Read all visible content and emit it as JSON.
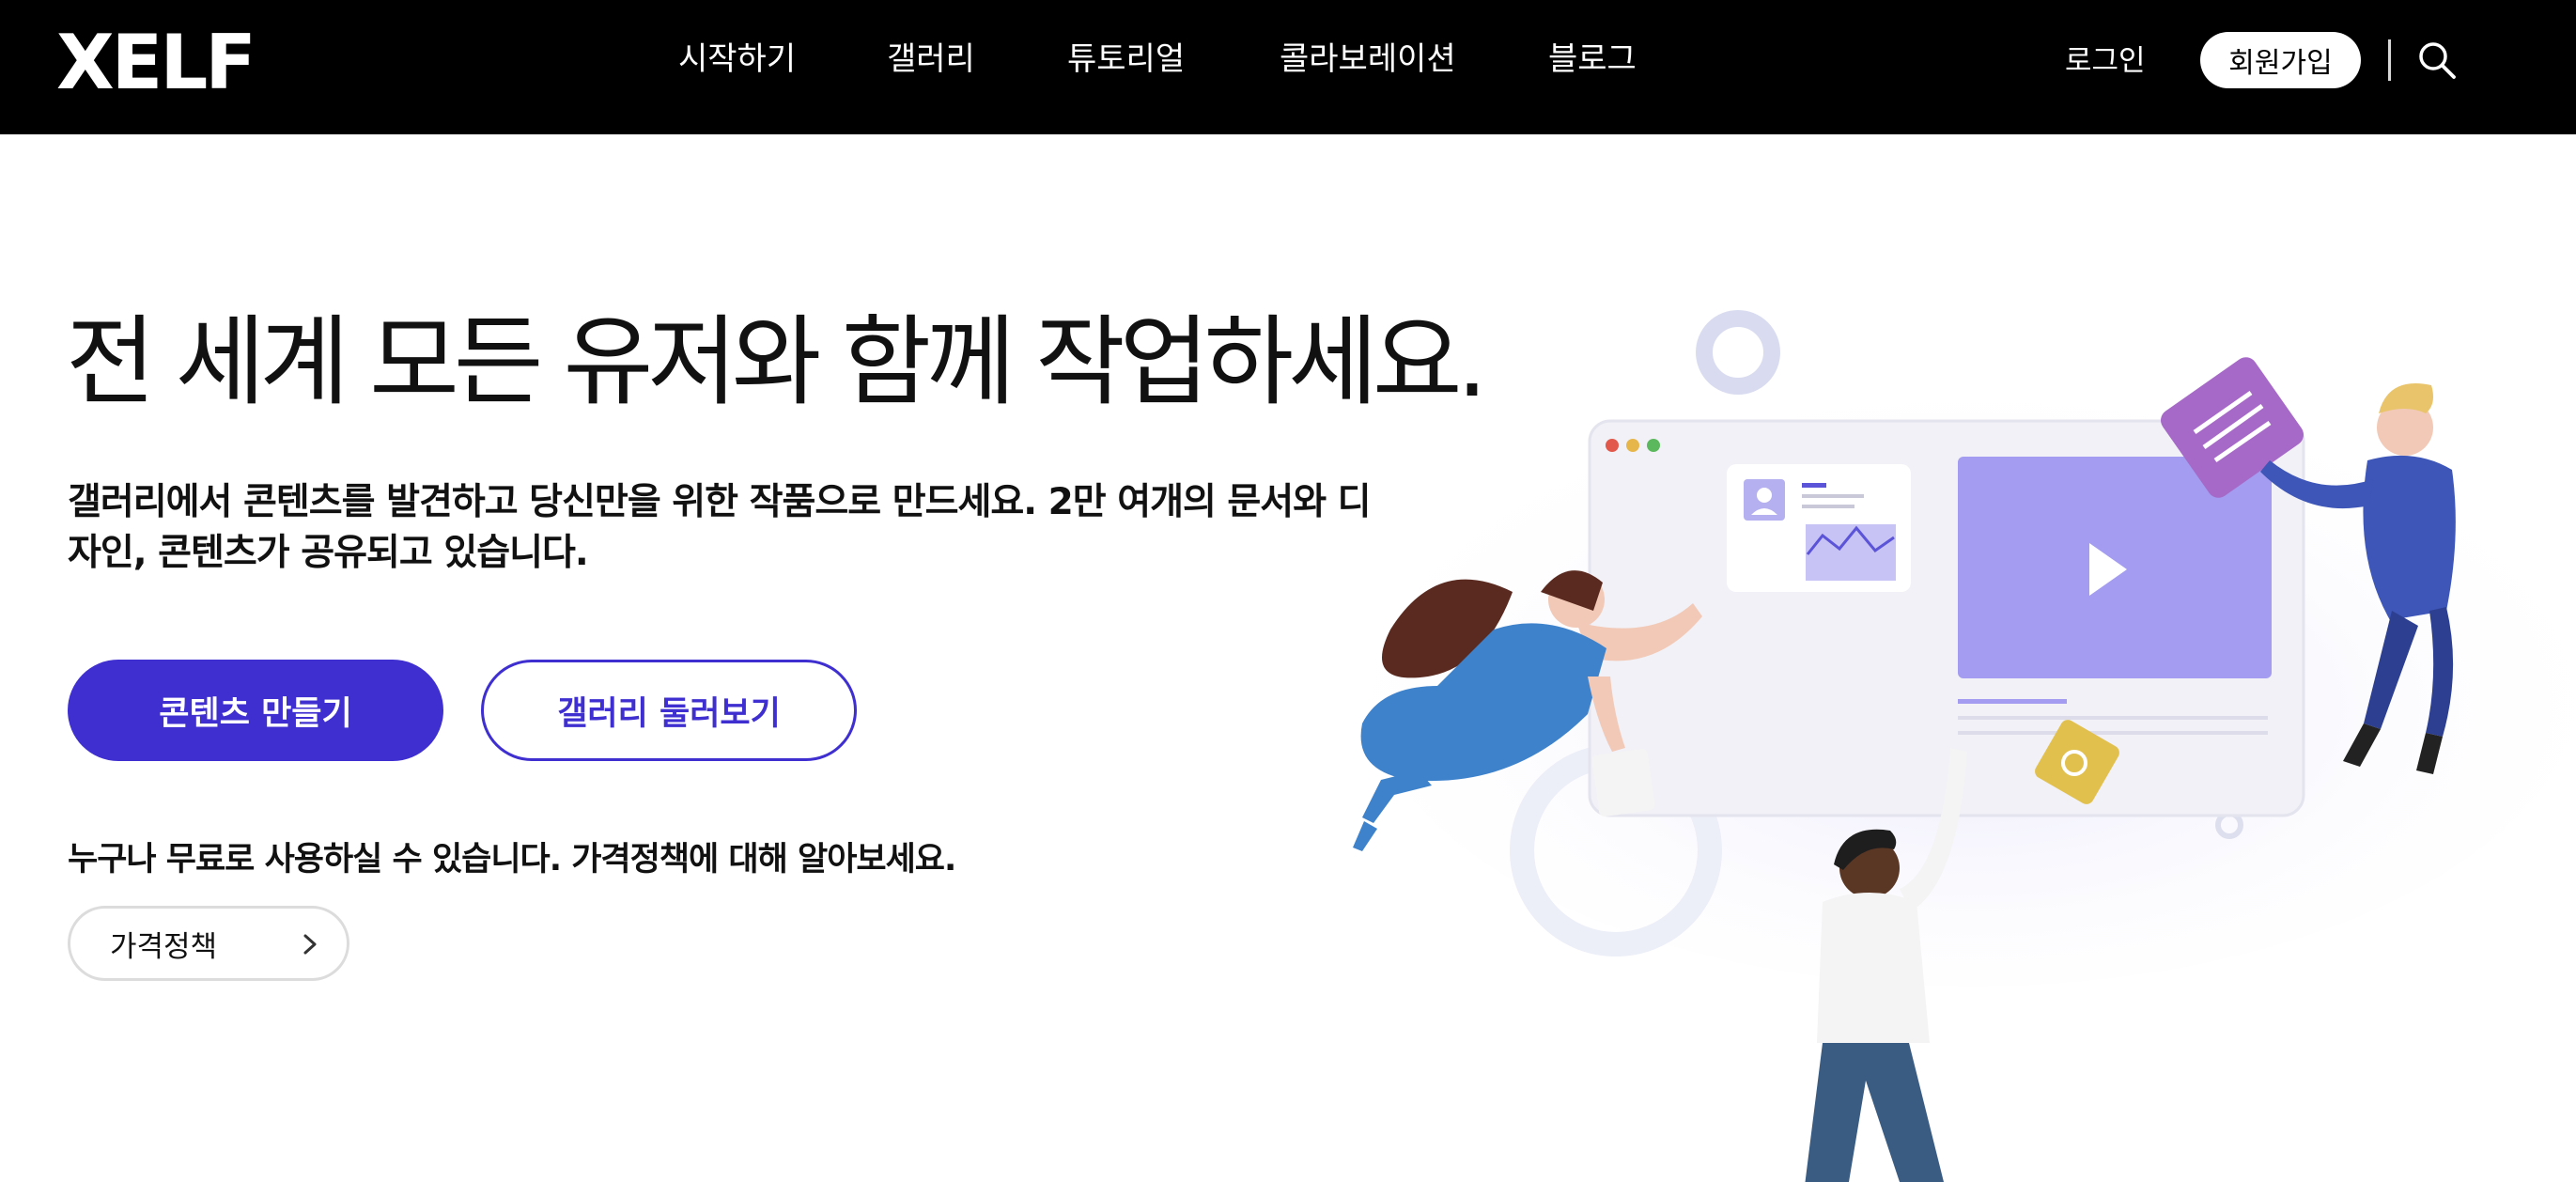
{
  "header": {
    "logo": "XELF",
    "nav": [
      "시작하기",
      "갤러리",
      "튜토리얼",
      "콜라보레이션",
      "블로그"
    ],
    "login": "로그인",
    "signup": "회원가입",
    "search_icon": "search-icon"
  },
  "hero": {
    "title": "전 세계 모든 유저와 함께 작업하세요.",
    "description": "갤러리에서 콘텐츠를 발견하고 당신만을 위한 작품으로 만드세요. 2만 여개의 문서와 디자인, 콘텐츠가 공유되고 있습니다.",
    "primary_button": "콘텐츠 만들기",
    "secondary_button": "갤러리 둘러보기",
    "free_note": "누구나 무료로 사용하실 수 있습니다. 가격정책에 대해 알아보세요.",
    "pricing_button": "가격정책"
  },
  "colors": {
    "header_bg": "#000000",
    "accent": "#3f2fd0",
    "text": "#111111"
  }
}
